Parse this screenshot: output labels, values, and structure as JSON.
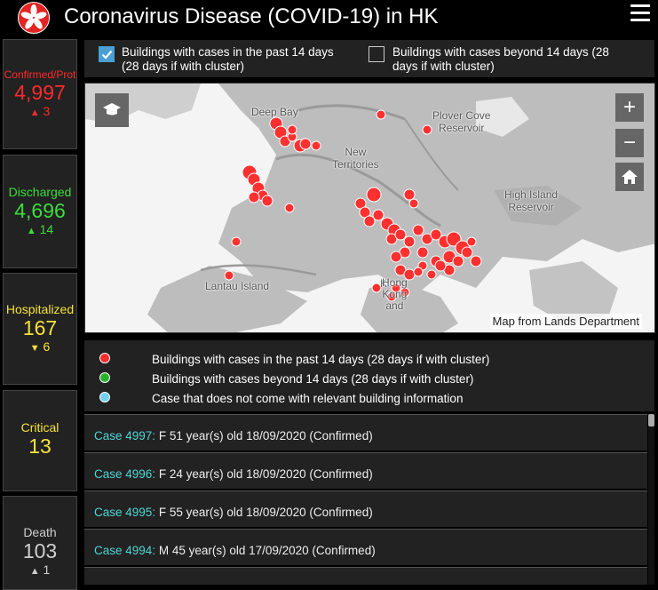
{
  "header": {
    "title": "Coronavirus Disease (COVID-19) in HK"
  },
  "stats": [
    {
      "label": "Confirmed/Prot",
      "value": "4,997",
      "delta": "3",
      "direction": "up",
      "color": "#ff2a2a"
    },
    {
      "label": "Discharged",
      "value": "4,696",
      "delta": "14",
      "direction": "up",
      "color": "#3cdc3c"
    },
    {
      "label": "Hospitalized",
      "value": "167",
      "delta": "6",
      "direction": "down",
      "color": "#f5e23a"
    },
    {
      "label": "Critical",
      "value": "13",
      "delta": "",
      "direction": "",
      "color": "#f5e23a"
    },
    {
      "label": "Death",
      "value": "103",
      "delta": "1",
      "direction": "up",
      "color": "#cfcfcf"
    }
  ],
  "filters": {
    "recent_label_1": "Buildings with cases in the past 14 days",
    "recent_label_2": "(28 days if with cluster)",
    "recent_checked": true,
    "beyond_label_1": "Buildings with cases beyond 14 days (28",
    "beyond_label_2": "days if with cluster)",
    "beyond_checked": false
  },
  "map": {
    "labels": {
      "deep_bay": "Deep Bay",
      "plover_cove_1": "Plover Cove",
      "plover_cove_2": "Reservoir",
      "new_1": "New",
      "new_2": "Territories",
      "high_island_1": "High Island",
      "high_island_2": "Reservoir",
      "lantau": "Lantau Island",
      "hong_1": "Hong",
      "hong_2": "Kong",
      "hong_3": "and",
      "kowloon": "K"
    },
    "credit": "Map from Lands Department",
    "zoom_in": "+",
    "zoom_out": "−",
    "marker_color": "#ff3030"
  },
  "legend": [
    {
      "text": "Buildings with cases in the past 14 days (28 days if with cluster)",
      "color": "#ff2a2a"
    },
    {
      "text": "Buildings with cases beyond 14 days (28 days if with cluster)",
      "color": "#2ab32a"
    },
    {
      "text": "Case that does not come with relevant building information",
      "color": "#6fd0f0"
    }
  ],
  "cases": [
    {
      "id": "Case 4997:",
      "detail": "F  51 year(s) old  18/09/2020 (Confirmed)"
    },
    {
      "id": "Case 4996:",
      "detail": "F  24 year(s) old  18/09/2020 (Confirmed)"
    },
    {
      "id": "Case 4995:",
      "detail": "F  55 year(s) old  18/09/2020 (Confirmed)"
    },
    {
      "id": "Case 4994:",
      "detail": "M  45 year(s) old  17/09/2020 (Confirmed)"
    }
  ]
}
